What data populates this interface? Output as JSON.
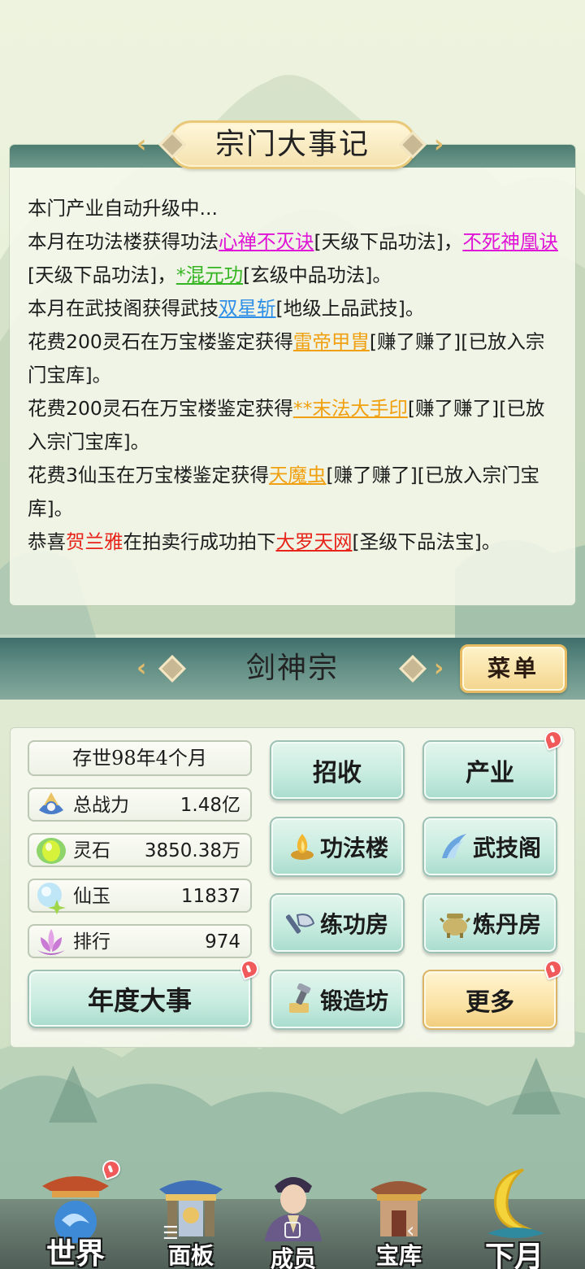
{
  "chronicle": {
    "title": "宗门大事记",
    "lines": [
      {
        "segments": [
          {
            "text": "本门产业自动升级中..."
          }
        ]
      },
      {
        "segments": [
          {
            "text": "本月在功法楼获得功法"
          },
          {
            "text": "心禅不灭诀",
            "color": "magenta"
          },
          {
            "text": "[天级下品功法]，"
          },
          {
            "text": "不死神凰诀",
            "color": "magenta"
          },
          {
            "text": "[天级下品功法]，"
          },
          {
            "text": "*混元功",
            "color": "green"
          },
          {
            "text": "[玄级中品功法]。"
          }
        ]
      },
      {
        "segments": [
          {
            "text": "本月在武技阁获得武技"
          },
          {
            "text": "双星斩",
            "color": "blue"
          },
          {
            "text": "[地级上品武技]。"
          }
        ]
      },
      {
        "segments": [
          {
            "text": "花费200灵石在万宝楼鉴定获得"
          },
          {
            "text": "雷帝甲胄",
            "color": "orange"
          },
          {
            "text": "[赚了赚了][已放入宗门宝库]。"
          }
        ]
      },
      {
        "segments": [
          {
            "text": "花费200灵石在万宝楼鉴定获得"
          },
          {
            "text": "**末法大手印",
            "color": "orange"
          },
          {
            "text": "[赚了赚了][已放入宗门宝库]。"
          }
        ]
      },
      {
        "segments": [
          {
            "text": "花费3仙玉在万宝楼鉴定获得"
          },
          {
            "text": "天魔虫",
            "color": "orange"
          },
          {
            "text": "[赚了赚了][已放入宗门宝库]。"
          }
        ]
      },
      {
        "segments": [
          {
            "text": "恭喜"
          },
          {
            "text": "贺兰雅",
            "color": "red-plain"
          },
          {
            "text": "在拍卖行成功拍下"
          },
          {
            "text": "大罗天网",
            "color": "red"
          },
          {
            "text": "[圣级下品法宝]。"
          }
        ]
      }
    ]
  },
  "sect": {
    "name": "剑神宗",
    "menu_label": "菜单"
  },
  "stats": {
    "age": "存世98年4个月",
    "power_label": "总战力",
    "power_value": "1.48亿",
    "stone_label": "灵石",
    "stone_value": "3850.38万",
    "jade_label": "仙玉",
    "jade_value": "11837",
    "rank_label": "排行",
    "rank_value": "974"
  },
  "buttons": {
    "recruit": "招收",
    "industry": "产业",
    "skill_tower": "功法楼",
    "martial_pavilion": "武技阁",
    "training_room": "练功房",
    "alchemy_room": "炼丹房",
    "annual_events": "年度大事",
    "forge": "锻造坊",
    "more": "更多"
  },
  "nav": {
    "world": "世界",
    "panel": "面板",
    "members": "成员",
    "treasury": "宝库",
    "next_month": "下月"
  },
  "colors": {
    "magenta": "#e014d6",
    "green": "#36b523",
    "blue": "#2f8fe6",
    "orange": "#f0a010",
    "red": "#e8241a",
    "panel_header": "#4d7c70"
  }
}
